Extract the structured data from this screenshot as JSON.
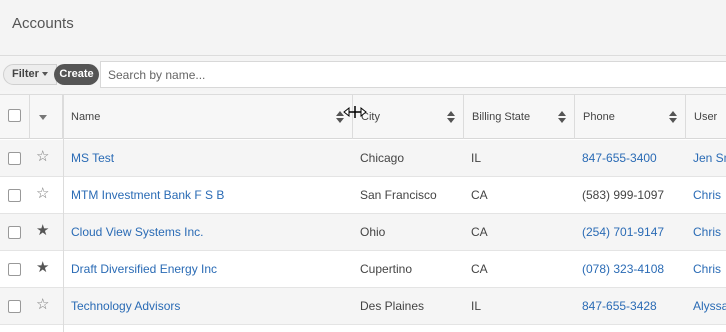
{
  "header": {
    "title": "Accounts"
  },
  "toolbar": {
    "filter_label": "Filter",
    "create_label": "Create",
    "search_placeholder": "Search by name..."
  },
  "columns": [
    {
      "label": "Name"
    },
    {
      "label": "City"
    },
    {
      "label": "Billing State"
    },
    {
      "label": "Phone"
    },
    {
      "label": "User"
    }
  ],
  "rows": [
    {
      "favorite": false,
      "name": "MS Test",
      "city": "Chicago",
      "state": "IL",
      "phone": "847-655-3400",
      "phone_is_link": true,
      "user": "Jen Smith"
    },
    {
      "favorite": false,
      "name": "MTM Investment Bank F S B",
      "city": "San Francisco",
      "state": "CA",
      "phone": "(583) 999-1097",
      "phone_is_link": false,
      "user": "Chris"
    },
    {
      "favorite": true,
      "name": "Cloud View Systems Inc.",
      "city": "Ohio",
      "state": "CA",
      "phone": "(254) 701-9147",
      "phone_is_link": true,
      "user": "Chris"
    },
    {
      "favorite": true,
      "name": "Draft Diversified Energy Inc",
      "city": "Cupertino",
      "state": "CA",
      "phone": "(078) 323-4108",
      "phone_is_link": true,
      "user": "Chris"
    },
    {
      "favorite": false,
      "name": "Technology Advisors",
      "city": "Des Plaines",
      "state": "IL",
      "phone": "847-655-3428",
      "phone_is_link": true,
      "user": "Alyssa"
    }
  ],
  "icons": {
    "star": "star-icon",
    "sort": "sort-icon",
    "caret": "chevron-down-icon",
    "resize": "column-resize-cursor-icon"
  },
  "colors": {
    "link": "#2a6bb5",
    "create_button": "#555555"
  }
}
